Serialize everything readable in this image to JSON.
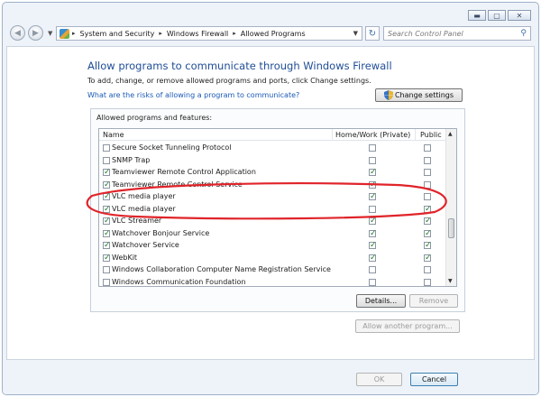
{
  "window": {
    "minimize_glyph": "▬",
    "maximize_glyph": "▢",
    "close_glyph": "✕"
  },
  "navbar": {
    "breadcrumbs": [
      "System and Security",
      "Windows Firewall",
      "Allowed Programs"
    ],
    "search_placeholder": "Search Control Panel"
  },
  "main": {
    "heading": "Allow programs to communicate through Windows Firewall",
    "subtitle": "To add, change, or remove allowed programs and ports, click Change settings.",
    "risk_link": "What are the risks of allowing a program to communicate?",
    "change_settings_label": "Change settings",
    "group_label": "Allowed programs and features:",
    "columns": {
      "name": "Name",
      "home": "Home/Work (Private)",
      "public": "Public"
    },
    "programs": [
      {
        "name": "Secure Socket Tunneling Protocol",
        "enabled": false,
        "home": false,
        "public": false
      },
      {
        "name": "SNMP Trap",
        "enabled": false,
        "home": false,
        "public": false
      },
      {
        "name": "Teamviewer Remote Control Application",
        "enabled": true,
        "home": true,
        "public": false
      },
      {
        "name": "Teamviewer Remote Control Service",
        "enabled": true,
        "home": true,
        "public": false
      },
      {
        "name": "VLC media player",
        "enabled": true,
        "home": true,
        "public": false
      },
      {
        "name": "VLC media player",
        "enabled": true,
        "home": false,
        "public": true
      },
      {
        "name": "VLC Streamer",
        "enabled": true,
        "home": true,
        "public": true
      },
      {
        "name": "Watchover Bonjour Service",
        "enabled": true,
        "home": true,
        "public": true
      },
      {
        "name": "Watchover Service",
        "enabled": true,
        "home": true,
        "public": true
      },
      {
        "name": "WebKit",
        "enabled": true,
        "home": true,
        "public": true
      },
      {
        "name": "Windows Collaboration Computer Name Registration Service",
        "enabled": false,
        "home": false,
        "public": false
      },
      {
        "name": "Windows Communication Foundation",
        "enabled": false,
        "home": false,
        "public": false
      }
    ],
    "details_label": "Details...",
    "remove_label": "Remove",
    "allow_another_label": "Allow another program..."
  },
  "footer": {
    "ok_label": "OK",
    "cancel_label": "Cancel"
  },
  "colors": {
    "heading": "#1f4d96",
    "link": "#1a59b6",
    "highlight": "#e0242a",
    "check": "#1e7a2b"
  }
}
